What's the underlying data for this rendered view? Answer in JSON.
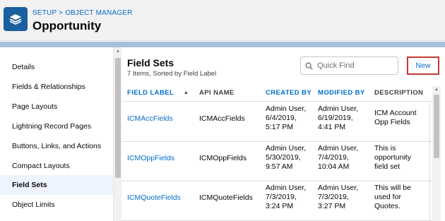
{
  "header": {
    "breadcrumb": {
      "setup": "SETUP",
      "separator": ">",
      "object_manager": "OBJECT MANAGER"
    },
    "title": "Opportunity",
    "icon": "layers-icon"
  },
  "sidebar": {
    "items": [
      {
        "label": "Details"
      },
      {
        "label": "Fields & Relationships"
      },
      {
        "label": "Page Layouts"
      },
      {
        "label": "Lightning Record Pages"
      },
      {
        "label": "Buttons, Links, and Actions"
      },
      {
        "label": "Compact Layouts"
      },
      {
        "label": "Field Sets",
        "active": true
      },
      {
        "label": "Object Limits"
      }
    ]
  },
  "main": {
    "title": "Field Sets",
    "subtitle": "7 Items, Sorted by Field Label",
    "search": {
      "placeholder": "Quick Find",
      "value": ""
    },
    "new_button": "New",
    "columns": [
      "FIELD LABEL",
      "API NAME",
      "CREATED BY",
      "MODIFIED BY",
      "DESCRIPTION"
    ],
    "rows": [
      {
        "field_label": "ICMAccFields",
        "api_name": "ICMAccFields",
        "created_by": {
          "user": "Admin User,",
          "date": "6/4/2019,",
          "time": "5:17 PM"
        },
        "modified_by": {
          "user": "Admin User,",
          "date": "6/19/2019,",
          "time": "4:41 PM"
        },
        "description": [
          "ICM Account",
          "Opp Fields"
        ]
      },
      {
        "field_label": "ICMOppFields",
        "api_name": "ICMOppFields",
        "created_by": {
          "user": "Admin User,",
          "date": "5/30/2019,",
          "time": "9:57 AM"
        },
        "modified_by": {
          "user": "Admin User,",
          "date": "7/4/2019,",
          "time": "10:04 AM"
        },
        "description": [
          "This is",
          "opportunity",
          "field set"
        ]
      },
      {
        "field_label": "ICMQuoteFields",
        "api_name": "ICMQuoteFields",
        "created_by": {
          "user": "Admin User,",
          "date": "7/3/2019,",
          "time": "3:24 PM"
        },
        "modified_by": {
          "user": "Admin User,",
          "date": "7/3/2019,",
          "time": "3:27 PM"
        },
        "description": [
          "This will be",
          "used for",
          "Quotes."
        ]
      }
    ]
  },
  "colors": {
    "link": "#006dcc",
    "app_icon": "#1b5f9e",
    "band": "#a4c0dd",
    "new_button_border": "#c23934",
    "active_item_bg": "#eef4ff"
  }
}
